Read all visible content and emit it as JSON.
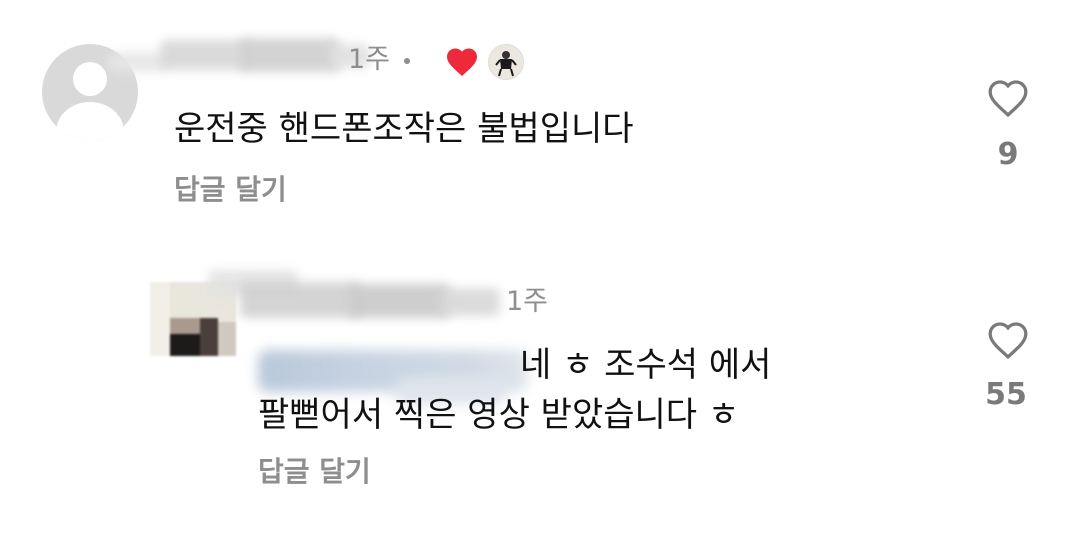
{
  "colors": {
    "text": "#111111",
    "meta": "#8e8e8e",
    "like_red": "#ee2a3a",
    "count": "#7a7a7a"
  },
  "comments": [
    {
      "time": "1주",
      "liked_by_creator": true,
      "text": "운전중 핸드폰조작은 불법입니다",
      "reply_label": "답글 달기",
      "like_count": "9",
      "icons": {
        "avatar": "default-avatar-icon",
        "creator_heart": "heart-filled-icon",
        "like": "heart-outline-icon"
      }
    },
    {
      "time": "1주",
      "text_line1": "네 ㅎ 조수석 에서",
      "text_line2": "팔뻗어서 찍은 영상 받았습니다 ㅎ",
      "reply_label": "답글 달기",
      "like_count": "55",
      "icons": {
        "like": "heart-outline-icon"
      }
    }
  ]
}
